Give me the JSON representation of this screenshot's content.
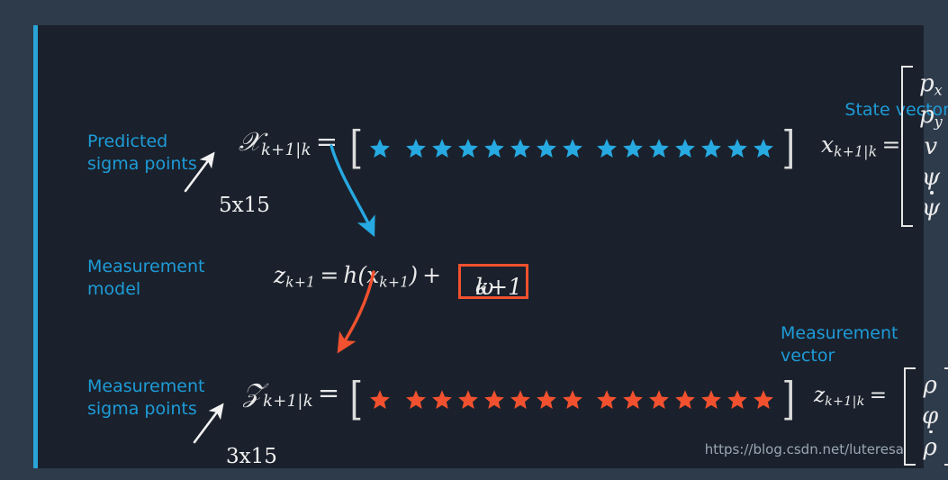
{
  "theme": {
    "outer_background": "#2e3b4b",
    "panel_background": "#1a212c",
    "accent_cyan": "#2aa4d6",
    "label_cyan": "#1e9bd7",
    "star_cyan": "#27a9e1",
    "star_red": "#f1512f",
    "highlight_red": "#f1512f",
    "math_white": "#ececec",
    "watermark_gray": "#9aa6b4"
  },
  "labels": {
    "predicted_sigma_points": "Predicted\nsigma points",
    "measurement_model": "Measurement\nmodel",
    "measurement_sigma_points": "Measurement\nsigma points",
    "state_vector": "State vector",
    "measurement_vector": "Measurement\nvector"
  },
  "dimensions": {
    "predicted": "5x15",
    "measured": "3x15"
  },
  "equations": {
    "predicted_sigma_matrix_lhs": "𝒳",
    "predicted_sigma_matrix_sub": "k+1|k",
    "state_vector_lhs": "x",
    "state_vector_sub": "k+1|k",
    "measurement_model_lhs": "z",
    "measurement_model_sub": "k+1",
    "measurement_model_rhs": "h(x",
    "measurement_model_rhs_sub": "k+1",
    "measurement_model_rhs_tail": ")",
    "measurement_model_plus": "+",
    "noise_term": "ω",
    "noise_term_sub": "k+1",
    "measurement_sigma_matrix_lhs": "𝒵",
    "measurement_sigma_matrix_sub": "k+1|k",
    "measurement_vector_lhs": "z",
    "measurement_vector_sub": "k+1|k",
    "equals": "="
  },
  "star_rows": {
    "predicted": {
      "color": "#27a9e1",
      "groups": [
        1,
        7,
        7
      ],
      "total": 15,
      "open_bracket": "[",
      "close_bracket": "]"
    },
    "measured": {
      "color": "#f1512f",
      "groups": [
        1,
        7,
        7
      ],
      "total": 15,
      "open_bracket": "[",
      "close_bracket": "]"
    }
  },
  "vectors": {
    "state": {
      "elements": [
        "p",
        "p",
        "v",
        "ψ",
        "ψ"
      ],
      "subscripts": [
        "x",
        "y",
        "",
        "",
        ""
      ],
      "dotted": [
        false,
        false,
        false,
        false,
        true
      ]
    },
    "measurement": {
      "elements": [
        "ρ",
        "φ",
        "ρ"
      ],
      "subscripts": [
        "",
        "",
        ""
      ],
      "dotted": [
        false,
        false,
        true
      ]
    }
  },
  "arrows": {
    "cyan_curve": {
      "label": "sigma-points-to-measurement-model",
      "color": "#27a9e1"
    },
    "red_curve": {
      "label": "measurement-model-to-measurement-sigma-points",
      "color": "#f1512f"
    },
    "white_predicted": {
      "label": "predicted-dimension-pointer",
      "color": "#f2f2f2"
    },
    "white_measured": {
      "label": "measured-dimension-pointer",
      "color": "#f2f2f2"
    }
  },
  "watermark": "https://blog.csdn.net/luteresa"
}
